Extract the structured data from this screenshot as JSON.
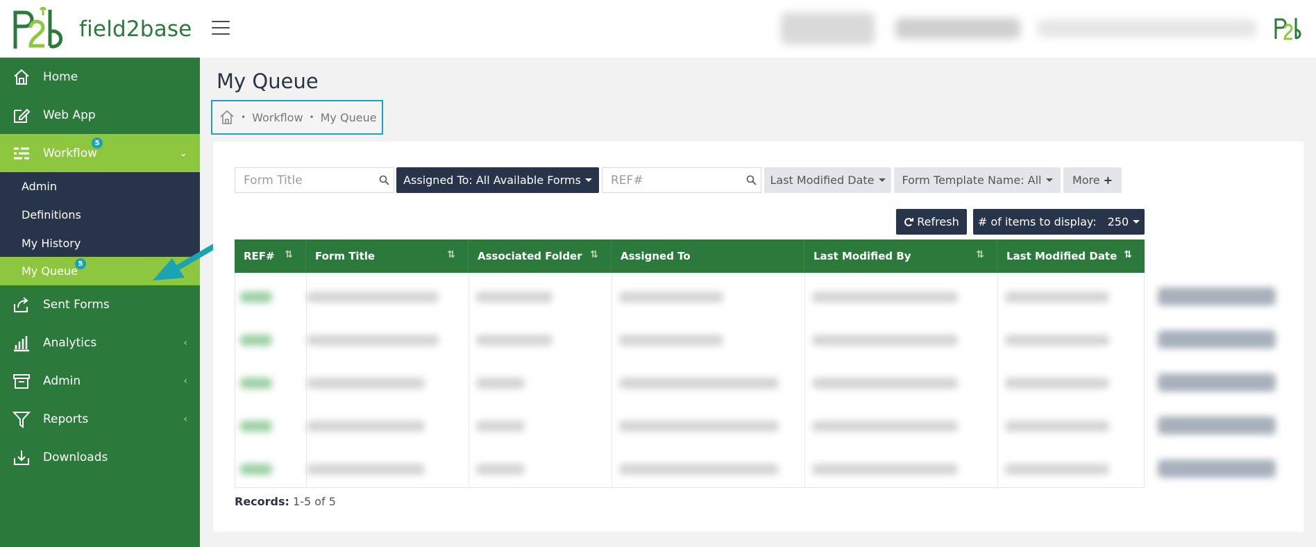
{
  "brand": {
    "name": "field2base",
    "color": "#2b7a3b",
    "accent": "#8dc63f",
    "callout": "#19a3b3"
  },
  "sidebar": {
    "items": [
      {
        "label": "Home",
        "icon": "home-icon"
      },
      {
        "label": "Web App",
        "icon": "edit-icon"
      },
      {
        "label": "Workflow",
        "icon": "workflow-icon",
        "badge": "5",
        "expanded": true
      },
      {
        "label": "Sent Forms",
        "icon": "share-icon"
      },
      {
        "label": "Analytics",
        "icon": "bar-chart-icon"
      },
      {
        "label": "Admin",
        "icon": "archive-icon"
      },
      {
        "label": "Reports",
        "icon": "filter-icon"
      },
      {
        "label": "Downloads",
        "icon": "download-icon"
      }
    ],
    "workflow_sub": [
      {
        "label": "Admin"
      },
      {
        "label": "Definitions"
      },
      {
        "label": "My History"
      },
      {
        "label": "My Queue",
        "badge": "5",
        "active": true
      }
    ]
  },
  "page": {
    "title": "My Queue",
    "breadcrumb": [
      "Workflow",
      "My Queue"
    ]
  },
  "filters": {
    "form_title_placeholder": "Form Title",
    "assigned_to_label": "Assigned To: All Available Forms",
    "ref_placeholder": "REF#",
    "last_modified_date_label": "Last Modified Date",
    "form_template_label": "Form Template Name: All",
    "more_label": "More"
  },
  "toolbar": {
    "refresh_label": "Refresh",
    "items_display_label": "# of items to display:",
    "items_display_value": "250"
  },
  "table": {
    "columns": [
      "REF#",
      "Form Title",
      "Associated Folder",
      "Assigned To",
      "Last Modified By",
      "Last Modified Date"
    ],
    "row_count": 5
  },
  "footer": {
    "records_label": "Records:",
    "records_value": "1-5 of 5"
  }
}
